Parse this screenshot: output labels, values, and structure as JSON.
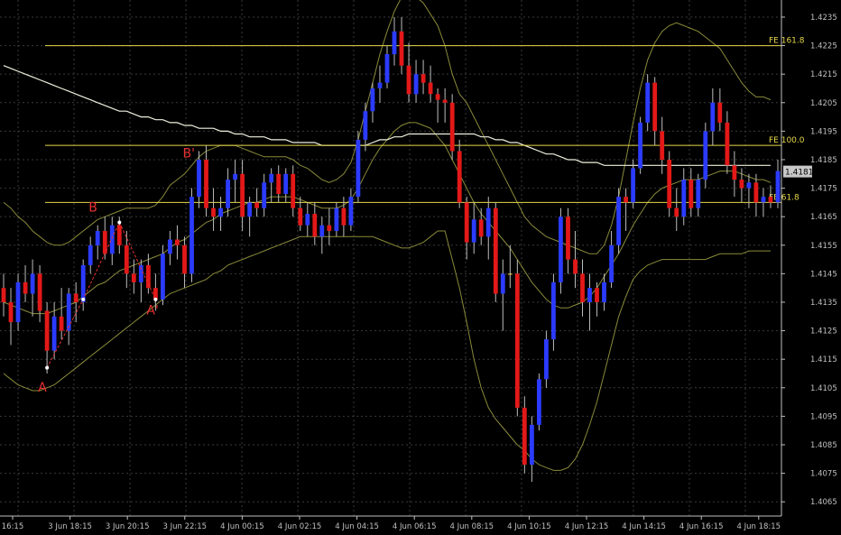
{
  "chart_data": {
    "type": "candlestick",
    "ylim": [
      1.406,
      1.4241
    ],
    "grid": true,
    "colors": {
      "background": "#000000",
      "grid": "#3a3a3a",
      "axis": "#c0c0c0",
      "bull": "#2b3bff",
      "bear": "#e31818",
      "neutral": "#ffdd44",
      "fib": "#e8d84a",
      "bands": "#8a8a3a",
      "ma": "#f0f0e0",
      "wave_line": "#e83030",
      "wave_label": "#e83030",
      "price_tag": "#c0c0c0"
    },
    "price_ticks": [
      "1.4235",
      "1.4225",
      "1.4215",
      "1.4205",
      "1.4195",
      "1.4185",
      "1.4175",
      "1.4165",
      "1.4155",
      "1.4145",
      "1.4135",
      "1.4125",
      "1.4115",
      "1.4105",
      "1.4095",
      "1.4085",
      "1.4075",
      "1.4065"
    ],
    "time_ticks": [
      "16:15",
      "3 Jun 18:15",
      "3 Jun 20:15",
      "3 Jun 22:15",
      "4 Jun 00:15",
      "4 Jun 02:15",
      "4 Jun 04:15",
      "4 Jun 06:15",
      "4 Jun 08:15",
      "4 Jun 10:15",
      "4 Jun 12:15",
      "4 Jun 14:15",
      "4 Jun 16:15",
      "4 Jun 18:15"
    ],
    "current_price": "1.4181",
    "fib_levels": [
      {
        "label": "FE 161.8",
        "value": 1.4225
      },
      {
        "label": "FE 100.0",
        "value": 1.419
      },
      {
        "label": "FE 61.8",
        "value": 1.417
      }
    ],
    "wave_labels": [
      {
        "text": "A",
        "index": 6,
        "price": 1.4105
      },
      {
        "text": "B",
        "index": 13,
        "price": 1.4168
      },
      {
        "text": "A'",
        "index": 21,
        "price": 1.4132
      },
      {
        "text": "B'",
        "index": 26,
        "price": 1.4187
      }
    ],
    "wave_points": [
      {
        "index": 6,
        "price": 1.4112
      },
      {
        "index": 11,
        "price": 1.4136
      },
      {
        "index": 16,
        "price": 1.4163
      },
      {
        "index": 21,
        "price": 1.4136
      }
    ],
    "candles": [
      [
        1.414,
        1.4145,
        1.413,
        1.4135
      ],
      [
        1.4135,
        1.414,
        1.412,
        1.4128
      ],
      [
        1.4128,
        1.4145,
        1.4125,
        1.4142
      ],
      [
        1.4142,
        1.4148,
        1.4135,
        1.4138
      ],
      [
        1.4138,
        1.415,
        1.413,
        1.4145
      ],
      [
        1.4145,
        1.4148,
        1.4128,
        1.4132
      ],
      [
        1.4132,
        1.4135,
        1.411,
        1.4118
      ],
      [
        1.4118,
        1.4135,
        1.4115,
        1.413
      ],
      [
        1.413,
        1.414,
        1.4122,
        1.4125
      ],
      [
        1.4125,
        1.414,
        1.412,
        1.4138
      ],
      [
        1.4138,
        1.4142,
        1.4128,
        1.4135
      ],
      [
        1.4135,
        1.415,
        1.4132,
        1.4148
      ],
      [
        1.4148,
        1.4158,
        1.4145,
        1.4155
      ],
      [
        1.4155,
        1.4162,
        1.415,
        1.416
      ],
      [
        1.416,
        1.4165,
        1.415,
        1.4152
      ],
      [
        1.4152,
        1.4165,
        1.4148,
        1.4162
      ],
      [
        1.4162,
        1.4165,
        1.4152,
        1.4155
      ],
      [
        1.4155,
        1.416,
        1.414,
        1.4145
      ],
      [
        1.4145,
        1.415,
        1.4138,
        1.4142
      ],
      [
        1.4142,
        1.415,
        1.4135,
        1.4148
      ],
      [
        1.4148,
        1.4152,
        1.4138,
        1.414
      ],
      [
        1.414,
        1.4145,
        1.4132,
        1.4136
      ],
      [
        1.4136,
        1.4155,
        1.4134,
        1.4152
      ],
      [
        1.4152,
        1.416,
        1.4148,
        1.4157
      ],
      [
        1.4157,
        1.4162,
        1.415,
        1.4155
      ],
      [
        1.4155,
        1.4158,
        1.414,
        1.4145
      ],
      [
        1.4145,
        1.4175,
        1.4142,
        1.4172
      ],
      [
        1.4172,
        1.4188,
        1.4168,
        1.4185
      ],
      [
        1.4185,
        1.419,
        1.4165,
        1.4168
      ],
      [
        1.4168,
        1.4175,
        1.416,
        1.4165
      ],
      [
        1.4165,
        1.4172,
        1.416,
        1.4168
      ],
      [
        1.4168,
        1.4182,
        1.4165,
        1.4178
      ],
      [
        1.4178,
        1.4185,
        1.417,
        1.418
      ],
      [
        1.418,
        1.4185,
        1.416,
        1.4165
      ],
      [
        1.4165,
        1.4172,
        1.4158,
        1.417
      ],
      [
        1.417,
        1.4175,
        1.4165,
        1.4168
      ],
      [
        1.4168,
        1.418,
        1.4165,
        1.4177
      ],
      [
        1.4177,
        1.4182,
        1.417,
        1.418
      ],
      [
        1.418,
        1.4183,
        1.417,
        1.4173
      ],
      [
        1.4173,
        1.4182,
        1.417,
        1.418
      ],
      [
        1.418,
        1.4183,
        1.4165,
        1.4168
      ],
      [
        1.4168,
        1.4172,
        1.416,
        1.4162
      ],
      [
        1.4162,
        1.417,
        1.4158,
        1.4166
      ],
      [
        1.4166,
        1.417,
        1.4155,
        1.4158
      ],
      [
        1.4158,
        1.4165,
        1.4152,
        1.4162
      ],
      [
        1.4162,
        1.4168,
        1.4155,
        1.416
      ],
      [
        1.416,
        1.417,
        1.4158,
        1.4168
      ],
      [
        1.4168,
        1.4172,
        1.4158,
        1.4162
      ],
      [
        1.4162,
        1.4175,
        1.416,
        1.4172
      ],
      [
        1.4172,
        1.4195,
        1.417,
        1.4192
      ],
      [
        1.4192,
        1.4205,
        1.4188,
        1.4202
      ],
      [
        1.4202,
        1.4212,
        1.4198,
        1.421
      ],
      [
        1.421,
        1.4218,
        1.4205,
        1.4212
      ],
      [
        1.4212,
        1.4225,
        1.421,
        1.4222
      ],
      [
        1.4222,
        1.4235,
        1.4218,
        1.423
      ],
      [
        1.423,
        1.4235,
        1.4215,
        1.4218
      ],
      [
        1.4218,
        1.4226,
        1.4205,
        1.4208
      ],
      [
        1.4208,
        1.422,
        1.4205,
        1.4215
      ],
      [
        1.4215,
        1.422,
        1.4208,
        1.4212
      ],
      [
        1.4212,
        1.4218,
        1.4205,
        1.4208
      ],
      [
        1.4208,
        1.421,
        1.4198,
        1.4206
      ],
      [
        1.4206,
        1.421,
        1.4198,
        1.4205
      ],
      [
        1.4205,
        1.4208,
        1.4185,
        1.4188
      ],
      [
        1.4188,
        1.4192,
        1.4168,
        1.417
      ],
      [
        1.417,
        1.4172,
        1.415,
        1.4156
      ],
      [
        1.4156,
        1.417,
        1.4152,
        1.4164
      ],
      [
        1.4164,
        1.4168,
        1.4155,
        1.4158
      ],
      [
        1.4158,
        1.4172,
        1.415,
        1.4168
      ],
      [
        1.4168,
        1.417,
        1.4135,
        1.4138
      ],
      [
        1.4138,
        1.415,
        1.4125,
        1.4145
      ],
      [
        1.4145,
        1.4155,
        1.414,
        1.4145
      ],
      [
        1.4145,
        1.415,
        1.4095,
        1.4098
      ],
      [
        1.4098,
        1.4102,
        1.4075,
        1.4078
      ],
      [
        1.4078,
        1.4095,
        1.4072,
        1.4092
      ],
      [
        1.4092,
        1.411,
        1.409,
        1.4108
      ],
      [
        1.4108,
        1.4125,
        1.4105,
        1.4122
      ],
      [
        1.4122,
        1.4145,
        1.4118,
        1.4142
      ],
      [
        1.4142,
        1.4168,
        1.4138,
        1.4165
      ],
      [
        1.4165,
        1.4168,
        1.4145,
        1.415
      ],
      [
        1.415,
        1.416,
        1.414,
        1.4145
      ],
      [
        1.4145,
        1.415,
        1.413,
        1.4135
      ],
      [
        1.4135,
        1.4145,
        1.4125,
        1.414
      ],
      [
        1.414,
        1.4142,
        1.413,
        1.4135
      ],
      [
        1.4135,
        1.4145,
        1.4132,
        1.4142
      ],
      [
        1.4142,
        1.416,
        1.414,
        1.4155
      ],
      [
        1.4155,
        1.4175,
        1.4152,
        1.4172
      ],
      [
        1.4172,
        1.4175,
        1.416,
        1.417
      ],
      [
        1.417,
        1.4185,
        1.4168,
        1.4182
      ],
      [
        1.4182,
        1.42,
        1.418,
        1.4198
      ],
      [
        1.4198,
        1.4215,
        1.4195,
        1.4212
      ],
      [
        1.4212,
        1.4214,
        1.419,
        1.4195
      ],
      [
        1.4195,
        1.42,
        1.418,
        1.4185
      ],
      [
        1.4185,
        1.4188,
        1.4165,
        1.4168
      ],
      [
        1.4168,
        1.4175,
        1.416,
        1.4165
      ],
      [
        1.4165,
        1.4182,
        1.4162,
        1.4178
      ],
      [
        1.4178,
        1.4182,
        1.4165,
        1.4168
      ],
      [
        1.4168,
        1.418,
        1.4165,
        1.4178
      ],
      [
        1.4178,
        1.4198,
        1.4175,
        1.4195
      ],
      [
        1.4195,
        1.421,
        1.419,
        1.4205
      ],
      [
        1.4205,
        1.421,
        1.4195,
        1.4198
      ],
      [
        1.4198,
        1.4202,
        1.418,
        1.4183
      ],
      [
        1.4183,
        1.4188,
        1.4172,
        1.4178
      ],
      [
        1.4178,
        1.4182,
        1.417,
        1.4175
      ],
      [
        1.4175,
        1.418,
        1.4168,
        1.4177
      ],
      [
        1.4177,
        1.418,
        1.4165,
        1.417
      ],
      [
        1.417,
        1.4175,
        1.4165,
        1.4172
      ],
      [
        1.4172,
        1.4176,
        1.4168,
        1.417
      ],
      [
        1.417,
        1.4185,
        1.4168,
        1.4181
      ]
    ],
    "upper_band": [
      1.417,
      1.4168,
      1.4165,
      1.4163,
      1.416,
      1.4158,
      1.4156,
      1.4155,
      1.4155,
      1.4156,
      1.4158,
      1.416,
      1.4162,
      1.4164,
      1.4165,
      1.4166,
      1.4167,
      1.4168,
      1.4168,
      1.4168,
      1.4168,
      1.4169,
      1.4172,
      1.4176,
      1.4178,
      1.418,
      1.4183,
      1.4186,
      1.4188,
      1.4189,
      1.419,
      1.419,
      1.419,
      1.4189,
      1.4188,
      1.4187,
      1.4186,
      1.4186,
      1.4186,
      1.4186,
      1.4185,
      1.4183,
      1.4182,
      1.418,
      1.4178,
      1.4177,
      1.4178,
      1.418,
      1.4184,
      1.4192,
      1.4202,
      1.4212,
      1.4222,
      1.423,
      1.4237,
      1.4242,
      1.4243,
      1.4242,
      1.424,
      1.4236,
      1.4232,
      1.4225,
      1.4215,
      1.4208,
      1.4205,
      1.42,
      1.4195,
      1.419,
      1.4185,
      1.418,
      1.4175,
      1.417,
      1.4165,
      1.4162,
      1.416,
      1.4158,
      1.4157,
      1.4156,
      1.4155,
      1.4154,
      1.4153,
      1.4152,
      1.4152,
      1.4155,
      1.4162,
      1.4172,
      1.4185,
      1.4198,
      1.421,
      1.422,
      1.4226,
      1.423,
      1.4232,
      1.4233,
      1.4232,
      1.4231,
      1.423,
      1.4228,
      1.4226,
      1.4224,
      1.422,
      1.4216,
      1.4212,
      1.4209,
      1.4207,
      1.4207,
      1.4206
    ],
    "middle_band": [
      1.4135,
      1.4134,
      1.4133,
      1.4132,
      1.4131,
      1.4131,
      1.4131,
      1.4132,
      1.4133,
      1.4134,
      1.4135,
      1.4137,
      1.4139,
      1.4141,
      1.4142,
      1.4144,
      1.4146,
      1.4147,
      1.4148,
      1.4149,
      1.415,
      1.4151,
      1.4152,
      1.4154,
      1.4156,
      1.4157,
      1.4159,
      1.4161,
      1.4163,
      1.4164,
      1.4166,
      1.4167,
      1.4168,
      1.4169,
      1.417,
      1.417,
      1.4171,
      1.4172,
      1.4172,
      1.4172,
      1.4172,
      1.4171,
      1.417,
      1.4169,
      1.4168,
      1.4168,
      1.4168,
      1.4169,
      1.4171,
      1.4175,
      1.418,
      1.4185,
      1.4189,
      1.4192,
      1.4195,
      1.4197,
      1.4198,
      1.4198,
      1.4197,
      1.4196,
      1.4193,
      1.419,
      1.4185,
      1.418,
      1.4175,
      1.417,
      1.4166,
      1.4163,
      1.416,
      1.4157,
      1.4154,
      1.415,
      1.4146,
      1.4142,
      1.4139,
      1.4136,
      1.4134,
      1.4133,
      1.4133,
      1.4134,
      1.4135,
      1.4137,
      1.414,
      1.4144,
      1.4148,
      1.4152,
      1.4157,
      1.4162,
      1.4166,
      1.417,
      1.4173,
      1.4175,
      1.4176,
      1.4177,
      1.4178,
      1.4178,
      1.4178,
      1.4179,
      1.418,
      1.4181,
      1.4181,
      1.4181,
      1.418,
      1.4179,
      1.4178,
      1.4178,
      1.4177
    ],
    "lower_band": [
      1.411,
      1.4108,
      1.4106,
      1.4105,
      1.4104,
      1.4104,
      1.4105,
      1.4106,
      1.4108,
      1.411,
      1.4112,
      1.4114,
      1.4116,
      1.4118,
      1.412,
      1.4122,
      1.4124,
      1.4126,
      1.4128,
      1.413,
      1.4132,
      1.4134,
      1.4136,
      1.4138,
      1.4139,
      1.414,
      1.4141,
      1.4142,
      1.4143,
      1.4145,
      1.4146,
      1.4148,
      1.4149,
      1.415,
      1.4151,
      1.4152,
      1.4153,
      1.4154,
      1.4155,
      1.4156,
      1.4157,
      1.4158,
      1.4158,
      1.4158,
      1.4158,
      1.4158,
      1.4158,
      1.4158,
      1.4158,
      1.4158,
      1.4158,
      1.4158,
      1.4157,
      1.4156,
      1.4155,
      1.4154,
      1.4154,
      1.4155,
      1.4156,
      1.4158,
      1.416,
      1.416,
      1.415,
      1.414,
      1.4128,
      1.4115,
      1.4105,
      1.4098,
      1.4094,
      1.4091,
      1.4088,
      1.4085,
      1.4083,
      1.408,
      1.4078,
      1.4077,
      1.4076,
      1.4076,
      1.4077,
      1.408,
      1.4085,
      1.4092,
      1.41,
      1.411,
      1.412,
      1.413,
      1.4137,
      1.4143,
      1.4146,
      1.4148,
      1.4149,
      1.415,
      1.415,
      1.415,
      1.415,
      1.415,
      1.415,
      1.415,
      1.4151,
      1.4152,
      1.4152,
      1.4152,
      1.4152,
      1.4153,
      1.4153,
      1.4153,
      1.4153
    ],
    "moving_average": [
      1.4218,
      1.4217,
      1.4216,
      1.4215,
      1.4214,
      1.4213,
      1.4212,
      1.4211,
      1.421,
      1.4209,
      1.4208,
      1.4207,
      1.4206,
      1.4205,
      1.4204,
      1.4203,
      1.4202,
      1.4202,
      1.4201,
      1.42,
      1.42,
      1.4199,
      1.4199,
      1.4198,
      1.4198,
      1.4197,
      1.4197,
      1.4196,
      1.4196,
      1.4196,
      1.4195,
      1.4195,
      1.4194,
      1.4194,
      1.4193,
      1.4193,
      1.4193,
      1.4192,
      1.4192,
      1.4192,
      1.4191,
      1.4191,
      1.4191,
      1.4191,
      1.419,
      1.419,
      1.419,
      1.419,
      1.419,
      1.419,
      1.419,
      1.4191,
      1.4192,
      1.4192,
      1.4193,
      1.4193,
      1.4194,
      1.4194,
      1.4194,
      1.4194,
      1.4194,
      1.4194,
      1.4194,
      1.4194,
      1.4194,
      1.4194,
      1.4193,
      1.4193,
      1.4192,
      1.4192,
      1.4191,
      1.4191,
      1.419,
      1.4189,
      1.4188,
      1.4187,
      1.4187,
      1.4186,
      1.4185,
      1.4185,
      1.4184,
      1.4184,
      1.4184,
      1.4183,
      1.4183,
      1.4183,
      1.4183,
      1.4183,
      1.4183,
      1.4183,
      1.4183,
      1.4183,
      1.4183,
      1.4183,
      1.4183,
      1.4183,
      1.4183,
      1.4183,
      1.4183,
      1.4183,
      1.4183,
      1.4183,
      1.4183,
      1.4183,
      1.4183,
      1.4183,
      1.4183
    ]
  }
}
